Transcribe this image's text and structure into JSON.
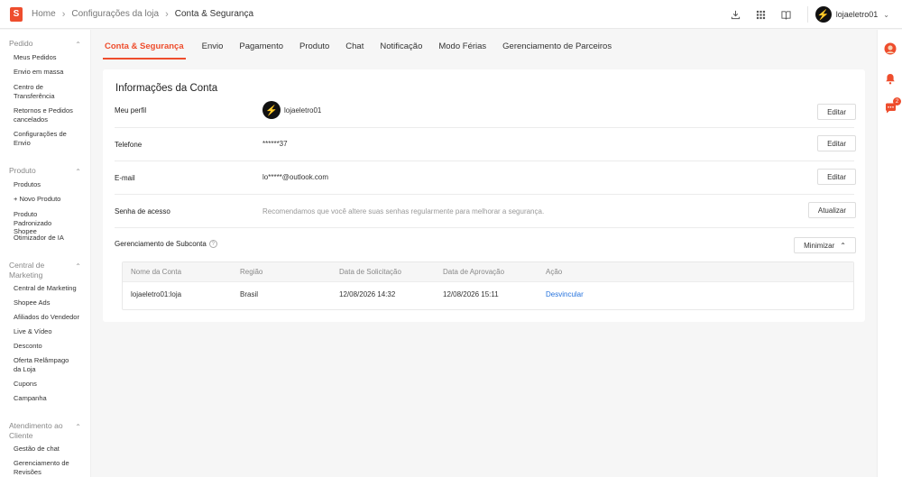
{
  "header": {
    "logo_letter": "S",
    "breadcrumbs": [
      "Home",
      "Configurações da loja",
      "Conta & Segurança"
    ],
    "username": "lojaeletro01"
  },
  "sidebar": {
    "groups": [
      {
        "title": "Pedido",
        "items": [
          "Meus Pedidos",
          "Envio em massa",
          "Centro de Transferência",
          "Retornos e Pedidos cancelados",
          "Configurações de Envio"
        ]
      },
      {
        "title": "Produto",
        "items": [
          "Produtos",
          "+ Novo Produto",
          "Produto Padronizado Shopee",
          "Otimizador de IA"
        ]
      },
      {
        "title": "Central de Marketing",
        "items": [
          "Central de Marketing",
          "Shopee Ads",
          "Afiliados do Vendedor",
          "Live & Vídeo",
          "Desconto",
          "Oferta Relâmpago da Loja",
          "Cupons",
          "Campanha"
        ]
      },
      {
        "title": "Atendimento ao Cliente",
        "items": [
          "Gestão de chat",
          "Gerenciamento de Revisões"
        ]
      }
    ]
  },
  "tabs": [
    "Conta & Segurança",
    "Envio",
    "Pagamento",
    "Produto",
    "Chat",
    "Notificação",
    "Modo Férias",
    "Gerenciamento de Parceiros"
  ],
  "account": {
    "title": "Informações da Conta",
    "profile_label": "Meu perfil",
    "profile_value": "lojaeletro01",
    "phone_label": "Telefone",
    "phone_value": "******37",
    "email_label": "E-mail",
    "email_value": "lo*****@outlook.com",
    "password_label": "Senha de acesso",
    "password_hint": "Recomendamos que você altere suas senhas regularmente para melhorar a segurança.",
    "edit_label": "Editar",
    "update_label": "Atualizar",
    "subaccount_label": "Gerenciamento de Subconta",
    "minimize_label": "Minimizar"
  },
  "subaccount_table": {
    "columns": [
      "Nome da Conta",
      "Região",
      "Data de Solicitação",
      "Data de Aprovação",
      "Ação"
    ],
    "rows": [
      {
        "name": "lojaeletro01:loja",
        "region": "Brasil",
        "requested": "12/08/2026 14:32",
        "approved": "12/08/2026 15:11",
        "action": "Desvincular"
      }
    ]
  },
  "rail": {
    "chat_badge": "2"
  },
  "colors": {
    "accent": "#ee4d2d",
    "link": "#2673dd"
  }
}
